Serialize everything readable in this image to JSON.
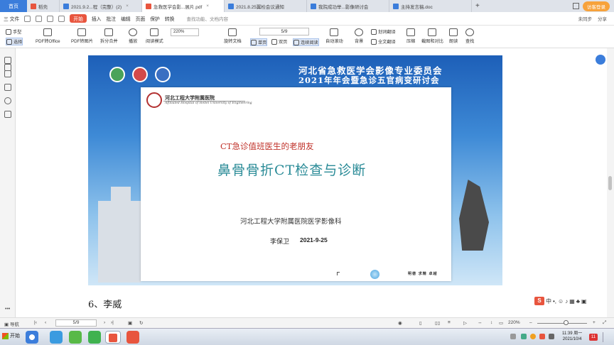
{
  "tabs": {
    "home": "首页",
    "items": [
      {
        "label": "稻壳",
        "icon": "docer-icon",
        "color": "#e8553e"
      },
      {
        "label": "2021.9.2...程（完整）(2)",
        "icon": "word-icon",
        "color": "#3b7ddb"
      },
      {
        "label": "急救医学会影...展片.pdf",
        "icon": "pdf-icon",
        "color": "#e8553e",
        "active": true
      },
      {
        "label": "2021.8.25翼检会议通知",
        "icon": "word-icon",
        "color": "#3b7ddb"
      },
      {
        "label": "我院成功举...影像研讨会",
        "icon": "word-icon",
        "color": "#3b7ddb"
      },
      {
        "label": "主持发言稿.doc",
        "icon": "word-icon",
        "color": "#3b7ddb"
      }
    ],
    "add": "+",
    "login": "访客登录"
  },
  "menu": {
    "file": "三 文件",
    "start": "开始",
    "items": [
      "插入",
      "批注",
      "编辑",
      "页面",
      "保护",
      "转换"
    ],
    "search": "查找功能、文档内容",
    "sync": "未同步",
    "share": "分享"
  },
  "toolbar": {
    "hand": "手型",
    "select": "选择",
    "pdf_to_office": "PDF转Office",
    "pdf_to_image": "PDF转图片",
    "split_merge": "拆分合并",
    "play": "播放",
    "read_mode": "阅读模式",
    "zoom": "220%",
    "rotate": "旋转文档",
    "page": "5/9",
    "single": "单页",
    "double": "双页",
    "continuous": "连续阅读",
    "auto_scroll": "自动滚动",
    "background": "背景",
    "translate": "划词翻译",
    "full_translate": "全文翻译",
    "compress": "压缩",
    "screenshot": "截图和对比",
    "read_aloud": "朗读",
    "find": "查找"
  },
  "slide": {
    "conference_line1": "河北省急救医学会影像专业委员会",
    "conference_line2": "2021年年会暨急诊五官病变研讨会",
    "hospital_name": "河北工程大学附属医院",
    "hospital_en": "Affiliated Hospital of Hebei University of Engineering",
    "subtitle": "CT急诊值班医生的老朋友",
    "title": "鼻骨骨折CT检查与诊断",
    "department": "河北工程大学附属医院医学影像科",
    "author": "李保卫",
    "date": "2021-9-25",
    "motto": "明德 求精 卓越"
  },
  "below_text": "6、李威",
  "ime": "中",
  "more": "•••",
  "status": {
    "nav": "导航",
    "page": "5/9",
    "zoom": "220%"
  },
  "taskbar": {
    "start": "开始",
    "time": "11:39 周一",
    "date": "2021/10/4",
    "badge": "11"
  }
}
